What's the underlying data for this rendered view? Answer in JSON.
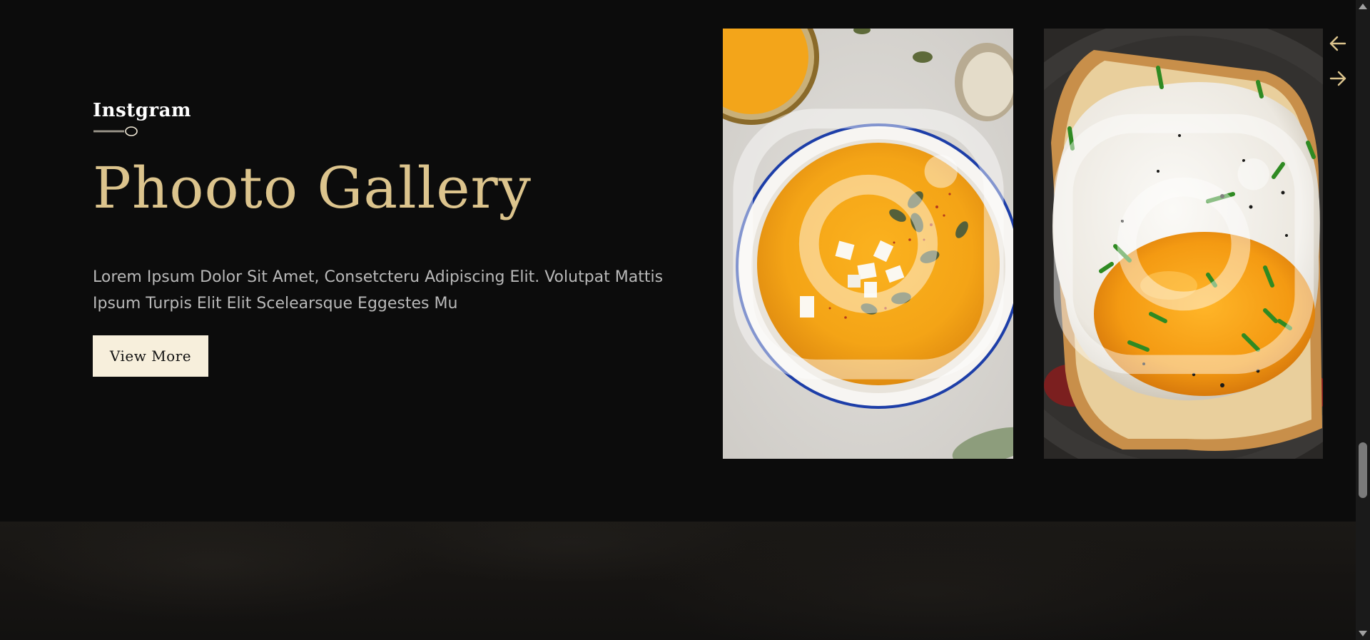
{
  "gallery": {
    "eyebrow": "Instgram",
    "title": "Phooto Gallery",
    "description": "Lorem Ipsum Dolor Sit Amet, Consetcteru Adipiscing Elit. Volutpat Mattis Ipsum Turpis Elit Elit Scelearsque Eggestes Mu",
    "button_label": "View More",
    "accent_color": "#dcc48d",
    "photos": [
      {
        "subject": "pumpkin-soup-bowl",
        "overlay_icon": "instagram-icon"
      },
      {
        "subject": "fried-egg-on-toast",
        "overlay_icon": "instagram-icon"
      }
    ],
    "nav": {
      "prev_icon": "arrow-left-icon",
      "next_icon": "arrow-right-icon"
    }
  }
}
